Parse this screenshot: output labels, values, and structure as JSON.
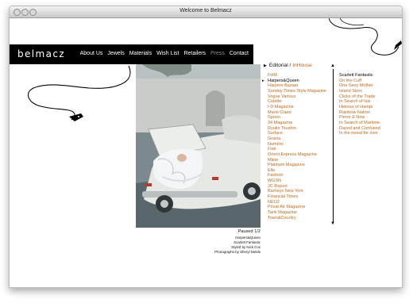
{
  "window": {
    "title": "Welcome to Belmacz"
  },
  "site": {
    "logo": "belmacz",
    "nav": [
      "About Us",
      "Jewels",
      "Materials",
      "Wish List",
      "Retailers",
      "Press",
      "Contact"
    ],
    "active_nav": "Press"
  },
  "breadcrumb": {
    "section": "Editorial",
    "subsection": "InHouse"
  },
  "press_list": [
    "FHM",
    "Harpers&Queen",
    "Harpers Bazaar",
    "Sunday Times Style Magazine",
    "Vogue Various",
    "Colette",
    "I-D Magazine",
    "Marie Claire",
    "Spoon",
    "34 Magazine",
    "Ryuko Tsushin",
    "Surface",
    "Grazia",
    "Numéro",
    "Flair",
    "Orient Express Magazine",
    "Mixte",
    "Platinum Magazine",
    "Elle",
    "Fashion",
    "WGSN",
    "JC Report",
    "Barneys New York",
    "Financial Times",
    "NEO2",
    "Privat Air Magazine",
    "Tank Magazine",
    "Town&Country"
  ],
  "selected_publication": "Harpers&Queen",
  "articles": {
    "heading": "Scarlett Fantastic",
    "items": [
      "On the Cuff",
      "One Sexy Mother",
      "Island Siren",
      "Clicks of the Trade",
      "In Search of Isis",
      "Heiress of Hampi",
      "Rainbow Nation",
      "Pierre & Now",
      "In Search of Marlene",
      "Dazed and Confused",
      "In the mood for love"
    ]
  },
  "slideshow": {
    "status": "Paused 1/2",
    "credits": [
      "Harpers&Queen",
      "Scarlett Fantastic",
      "Styled by Nick Cox",
      "Photographs by Sheryl Nields"
    ]
  },
  "colors": {
    "nav_bar": "#000000",
    "link": "#bd6a1b",
    "accent": "#c0620e"
  }
}
